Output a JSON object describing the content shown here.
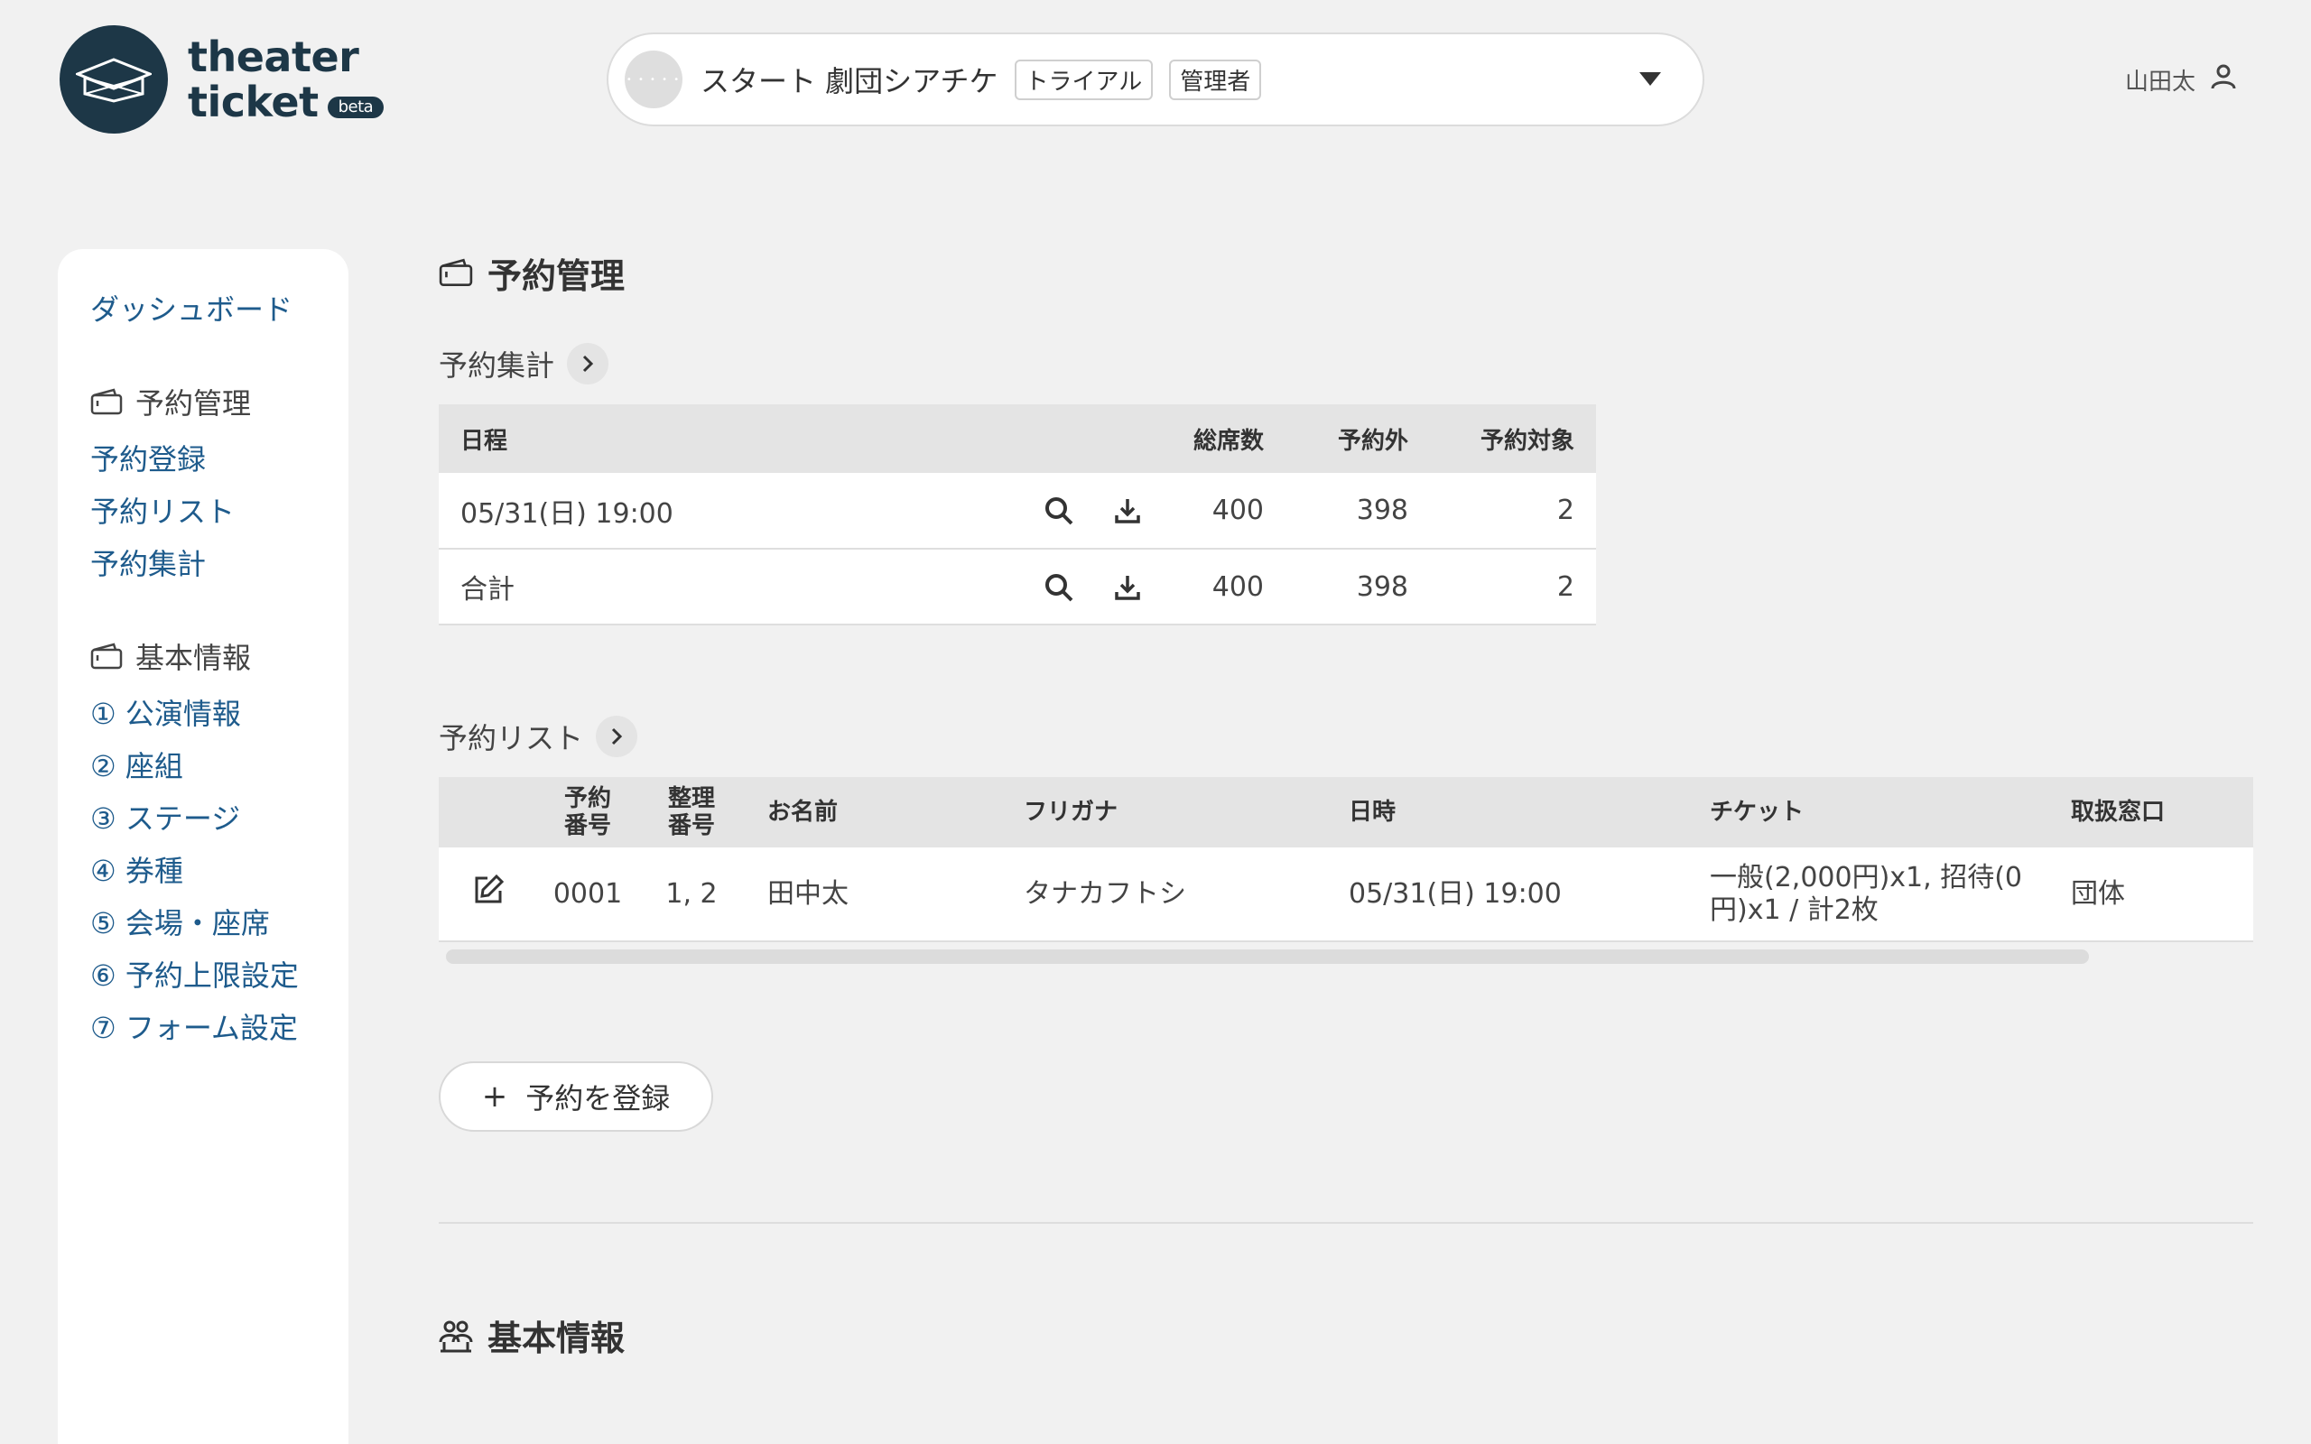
{
  "app": {
    "logo_line1": "theater",
    "logo_line2": "ticket",
    "logo_badge": "beta"
  },
  "project": {
    "name": "スタート 劇団シアチケ",
    "plan_tag": "トライアル",
    "role_tag": "管理者"
  },
  "user": {
    "name": "山田太"
  },
  "sidebar": {
    "dashboard": "ダッシュボード",
    "reservation_head": "予約管理",
    "reservation_items": [
      "予約登録",
      "予約リスト",
      "予約集計"
    ],
    "basic_head": "基本情報",
    "basic_items": [
      "① 公演情報",
      "② 座組",
      "③ ステージ",
      "④ 券種",
      "⑤ 会場・座席",
      "⑥ 予約上限設定",
      "⑦ フォーム設定"
    ]
  },
  "main": {
    "title": "予約管理",
    "summary": {
      "heading": "予約集計",
      "columns": [
        "日程",
        "総席数",
        "予約外",
        "予約対象"
      ],
      "rows": [
        {
          "label": "05/31(日) 19:00",
          "total": "400",
          "outside": "398",
          "target": "2"
        },
        {
          "label": "合計",
          "total": "400",
          "outside": "398",
          "target": "2"
        }
      ]
    },
    "list": {
      "heading": "予約リスト",
      "columns": {
        "no_line1": "予約",
        "no_line2": "番号",
        "seq_line1": "整理",
        "seq_line2": "番号",
        "name": "お名前",
        "kana": "フリガナ",
        "datetime": "日時",
        "ticket": "チケット",
        "window": "取扱窓口"
      },
      "rows": [
        {
          "no": "0001",
          "seq": "1, 2",
          "name": "田中太",
          "kana": "タナカフトシ",
          "datetime": "05/31(日) 19:00",
          "ticket": "一般(2,000円)x1, 招待(0円)x1 / 計2枚",
          "window": "団体"
        }
      ]
    },
    "add_button": "予約を登録",
    "add_plus": "+",
    "basic_title": "基本情報"
  },
  "colors": {
    "link": "#1e5b8c",
    "brand": "#1d3747",
    "background": "#f1f1f1"
  },
  "icons": [
    "graduation-cap-logo-icon",
    "chevron-down-icon",
    "user-icon",
    "wallet-icon",
    "chevron-right-icon",
    "search-icon",
    "download-icon",
    "edit-icon",
    "people-icon"
  ]
}
